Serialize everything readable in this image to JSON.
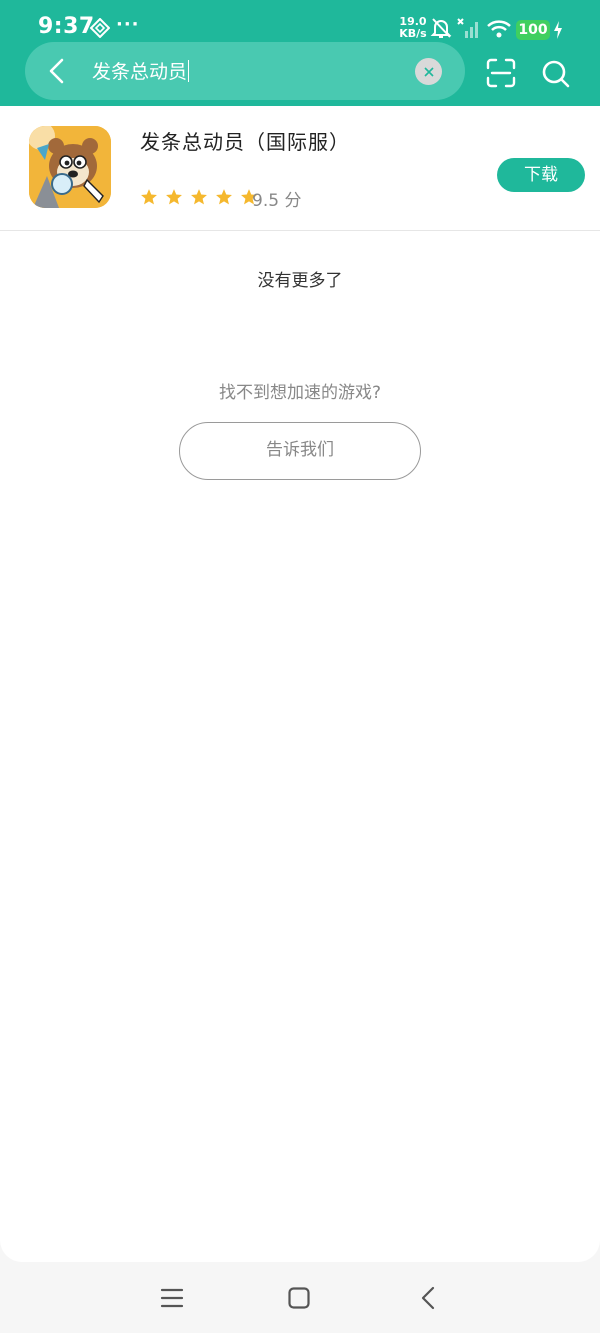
{
  "status_bar": {
    "time": "9:37",
    "more": "···",
    "speed_value": "19.0",
    "speed_unit": "KB/s",
    "battery": "100"
  },
  "search": {
    "query": "发条总动员"
  },
  "result": {
    "title": "发条总动员（国际服）",
    "stars": 5,
    "rating": "9.5 分",
    "download_label": "下载"
  },
  "no_more": "没有更多了",
  "cant_find": "找不到想加速的游戏?",
  "tell_us": "告诉我们",
  "colors": {
    "brand": "#1fb89b",
    "star": "#f5b82e",
    "battery": "#3fcf60"
  }
}
